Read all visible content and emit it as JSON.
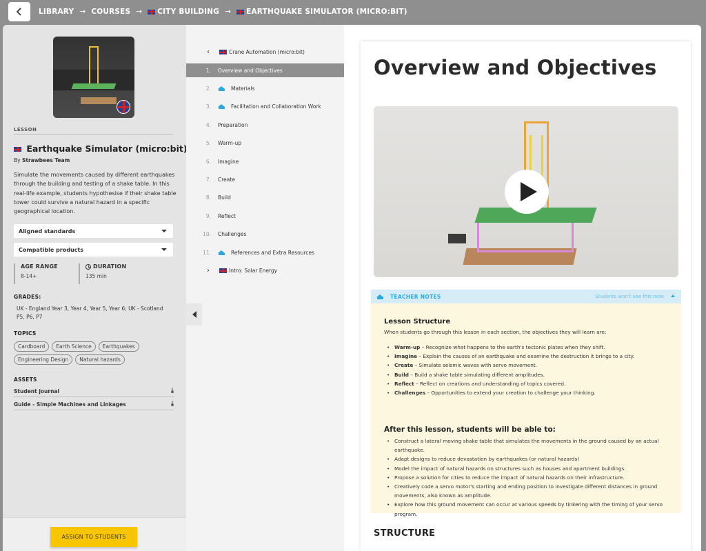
{
  "breadcrumb": {
    "items": [
      {
        "label": "LIBRARY",
        "flag": false
      },
      {
        "label": "COURSES",
        "flag": false
      },
      {
        "label": "CITY BUILDING",
        "flag": true
      },
      {
        "label": "EARTHQUAKE SIMULATOR (MICRO:BIT)",
        "flag": true
      }
    ],
    "separator": "→"
  },
  "lesson": {
    "section_label": "LESSON",
    "title": "Earthquake Simulator (micro:bit)",
    "author_prefix": "By",
    "author": "Strawbees Team",
    "description": "Simulate the movements caused by different earthquakes through the building and testing of a shake table. In this real-life example, students hypothesise if their shake table tower could survive a natural hazard in a specific geographical location.",
    "dropdowns": [
      "Aligned standards",
      "Compatible products"
    ],
    "age_range_label": "AGE RANGE",
    "age_range_value": "8-14+",
    "duration_label": "DURATION",
    "duration_value": "135 min",
    "grades_label": "GRADES:",
    "grades_value": "UK - England Year 3, Year 4, Year 5, Year 6; UK - Scotland P5, P6, P7",
    "topics_label": "TOPICS",
    "topics": [
      "Cardboard",
      "Earth Science",
      "Earthquakes",
      "Engineering Design",
      "Natural hazards"
    ],
    "assets_label": "ASSETS",
    "assets": [
      "Student journal",
      "Guide - Simple Machines and Linkages"
    ],
    "download_glyph": "⤓",
    "assign_label": "ASSIGN TO STUDENTS"
  },
  "nav": {
    "prev_parent": "Crane Automation (micro:bit)",
    "next_parent": "Intro: Solar Energy",
    "items": [
      {
        "num": "1.",
        "label": "Overview and Objectives",
        "teacher": false,
        "active": true
      },
      {
        "num": "2.",
        "label": "Materials",
        "teacher": true,
        "active": false
      },
      {
        "num": "3.",
        "label": "Facilitation and Collaboration Work",
        "teacher": true,
        "active": false
      },
      {
        "num": "4.",
        "label": "Preparation",
        "teacher": false,
        "active": false
      },
      {
        "num": "5.",
        "label": "Warm-up",
        "teacher": false,
        "active": false
      },
      {
        "num": "6.",
        "label": "Imagine",
        "teacher": false,
        "active": false
      },
      {
        "num": "7.",
        "label": "Create",
        "teacher": false,
        "active": false
      },
      {
        "num": "8.",
        "label": "Build",
        "teacher": false,
        "active": false
      },
      {
        "num": "9.",
        "label": "Reflect",
        "teacher": false,
        "active": false
      },
      {
        "num": "10.",
        "label": "Challenges",
        "teacher": false,
        "active": false
      },
      {
        "num": "11.",
        "label": "References and Extra Resources",
        "teacher": true,
        "active": false
      }
    ]
  },
  "content": {
    "title": "Overview and Objectives",
    "teacher_notes_title": "TEACHER NOTES",
    "teacher_notes_hint": "Students won't see this note",
    "lesson_structure_title": "Lesson Structure",
    "lesson_structure_intro": "When students go through this lesson in each section, the objectives they will learn are:",
    "lesson_structure_items": [
      {
        "term": "Warm-up",
        "text": " – Recognize what happens to the earth's tectonic plates when they shift."
      },
      {
        "term": "Imagine",
        "text": " – Explain the causes of an earthquake and examine the destruction it brings to a city."
      },
      {
        "term": "Create",
        "text": " – Simulate seismic waves with servo movement."
      },
      {
        "term": "Build",
        "text": " – Build a shake table simulating different amplitudes."
      },
      {
        "term": "Reflect",
        "text": " – Reflect on creations and understanding of topics covered."
      },
      {
        "term": "Challenges",
        "text": " – Opportunities to extend your creation to challenge your thinking."
      }
    ],
    "after_title": "After this lesson, students will be able to:",
    "after_items": [
      "Construct a lateral moving shake table that simulates the movements in the ground caused by an actual earthquake.",
      "Adapt designs to reduce devastation by earthquakes (or natural hazards)",
      "Model the impact of natural hazards on structures such as houses and apartment buildings.",
      "Propose a solution for cities to reduce the impact of natural hazards on their infrastructure.",
      "Creatively code a servo motor's starting and ending position to investigate different distances in ground movements, also known as amplitude.",
      "Explore how this ground movement can occur at various speeds by tinkering with the timing of your servo program."
    ],
    "structure_heading": "STRUCTURE"
  },
  "colors": {
    "accent_blue": "#29a9e0",
    "assign_yellow": "#f7c600",
    "active_nav": "#8f8f8f",
    "notes_bg": "#fdf7df"
  }
}
